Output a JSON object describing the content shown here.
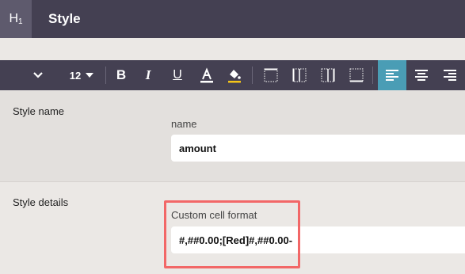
{
  "header": {
    "icon_label": "H",
    "icon_sub": "1",
    "title": "Style"
  },
  "toolbar": {
    "font_size": "12",
    "buttons": [
      "bold",
      "italic",
      "underline",
      "font-color",
      "fill-color",
      "border-all",
      "border-left-right",
      "border-inside",
      "border-outside",
      "align-left",
      "align-center",
      "align-right"
    ],
    "accent_color": "#4a9db5"
  },
  "style_name": {
    "section_label": "Style name",
    "field_label": "name",
    "value": "amount"
  },
  "style_details": {
    "section_label": "Style details",
    "field_label": "Custom cell format",
    "value": "#,##0.00;[Red]#,##0.00-"
  },
  "colors": {
    "header_bg": "#444052",
    "highlight_border": "#f26767"
  }
}
